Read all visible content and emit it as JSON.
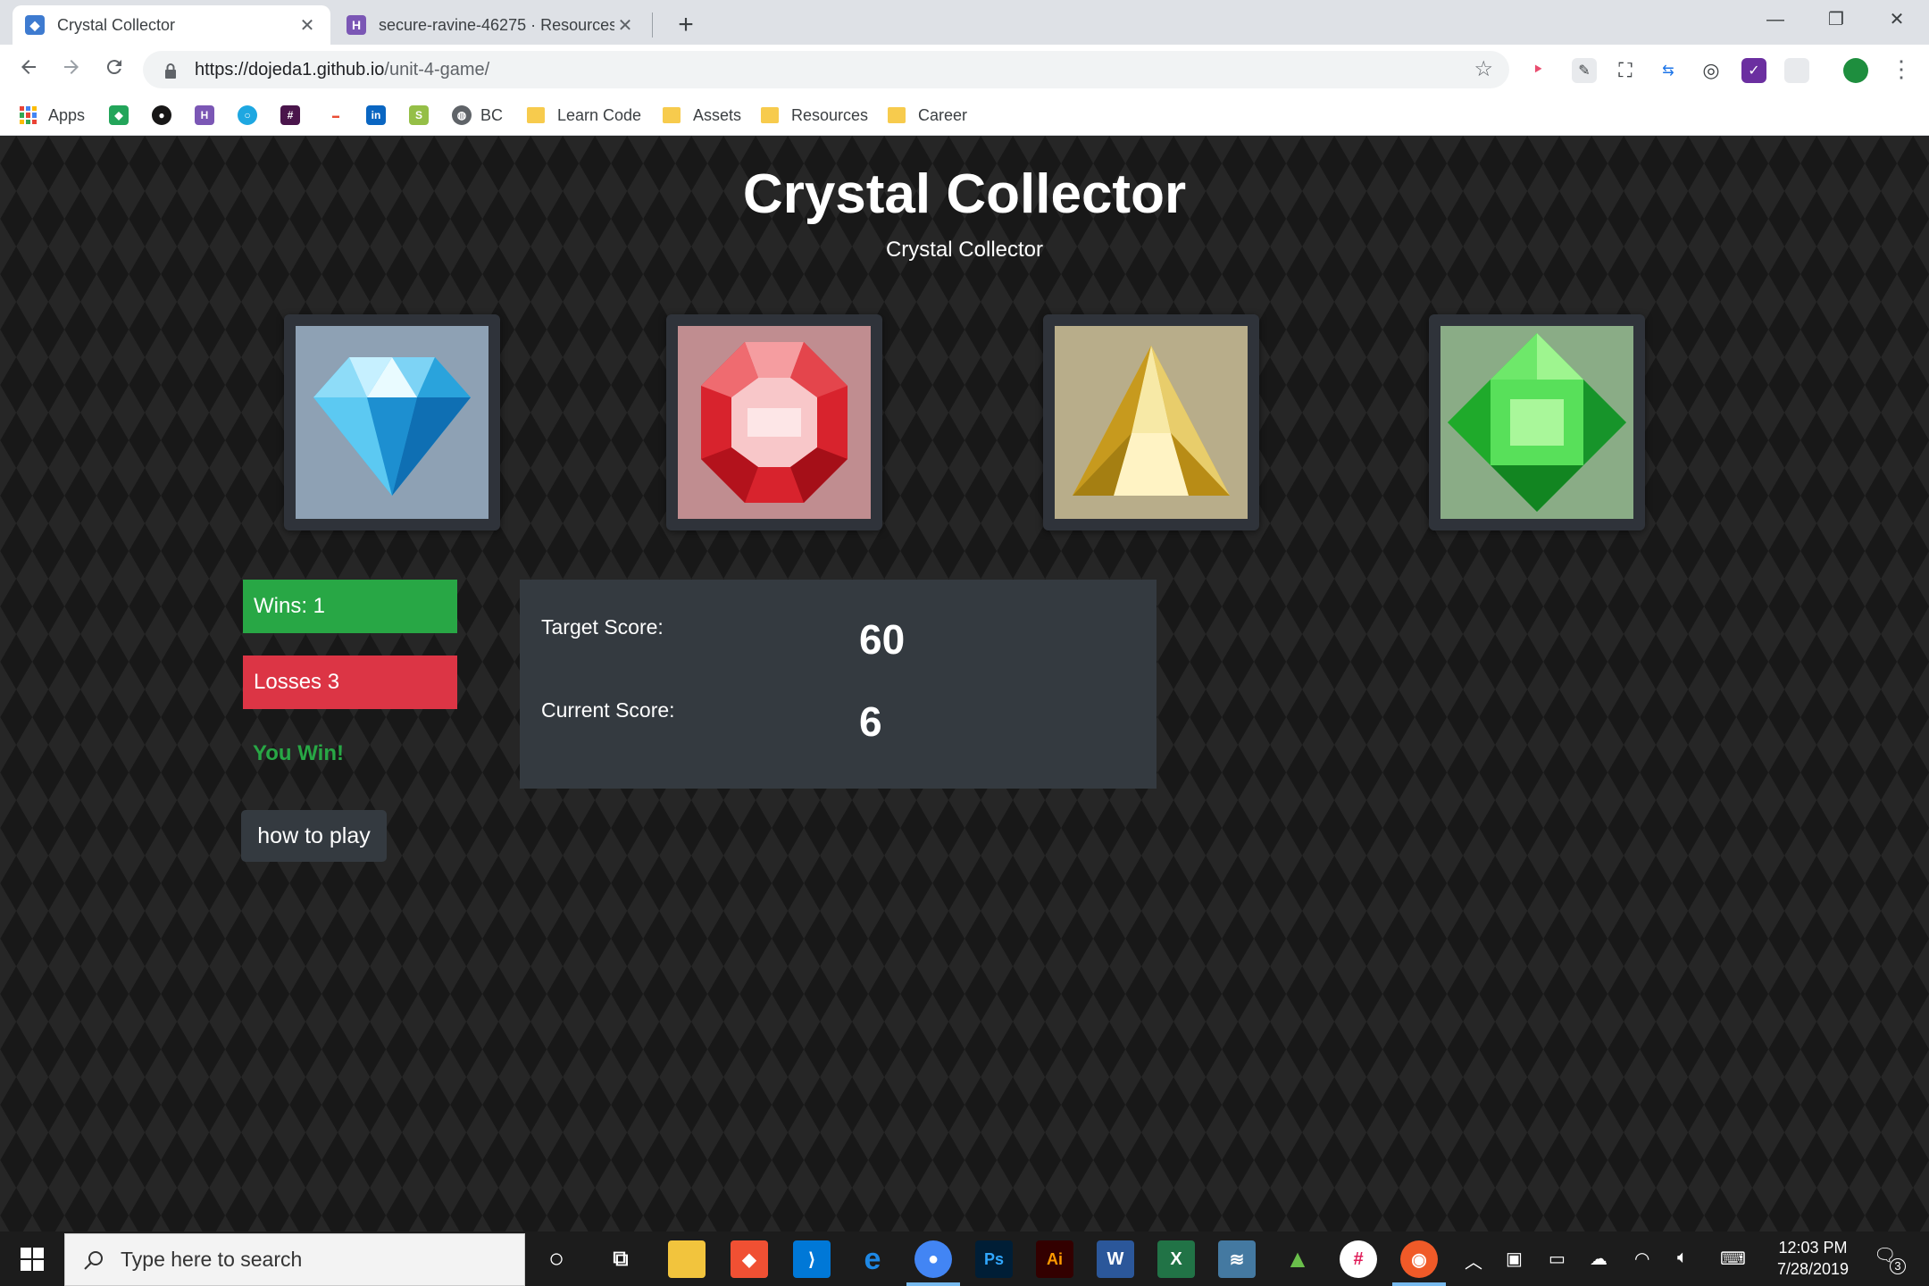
{
  "browser": {
    "tabs": [
      {
        "title": "Crystal Collector",
        "active": true,
        "favicon_color": "#3e7bd0",
        "close": "✕"
      },
      {
        "title": "secure-ravine-46275 · Resources",
        "active": false,
        "favicon_color": "#7b57b5",
        "close": "✕"
      }
    ],
    "new_tab": "+",
    "window_controls": {
      "minimize": "—",
      "restore": "❐",
      "close": "✕"
    },
    "url_host": "https://dojeda1.github.io",
    "url_path": "/unit-4-game/",
    "bookmarks": [
      {
        "label": "Apps",
        "type": "apps-grid"
      },
      {
        "label": "",
        "type": "app",
        "color": "#23a55a"
      },
      {
        "label": "",
        "type": "github",
        "color": "#181717"
      },
      {
        "label": "",
        "type": "app",
        "color": "#7b57b5"
      },
      {
        "label": "",
        "type": "app",
        "color": "#1ea7e1"
      },
      {
        "label": "",
        "type": "app",
        "color": "#4a154b"
      },
      {
        "label": "",
        "type": "app",
        "color": "#e94d35"
      },
      {
        "label": "",
        "type": "linkedin",
        "color": "#0a66c2"
      },
      {
        "label": "",
        "type": "shopify",
        "color": "#95bf47"
      },
      {
        "label": "BC",
        "type": "globe"
      },
      {
        "label": "Learn Code",
        "type": "folder"
      },
      {
        "label": "Assets",
        "type": "folder"
      },
      {
        "label": "Resources",
        "type": "folder"
      },
      {
        "label": "Career",
        "type": "folder"
      }
    ]
  },
  "game": {
    "title": "Crystal Collector",
    "subtitle": "Crystal Collector",
    "crystals": [
      {
        "name": "blue-diamond",
        "bg": "#8ea1b4",
        "color": "#3fb7ea"
      },
      {
        "name": "red-ruby",
        "bg": "#c08d90",
        "color": "#e2313a"
      },
      {
        "name": "yellow-topaz",
        "bg": "#b8ad8a",
        "color": "#d9b43a"
      },
      {
        "name": "green-emerald",
        "bg": "#8aac86",
        "color": "#2ec83a"
      }
    ],
    "wins_label": "Wins: 1",
    "losses_label": "Losses 3",
    "result": "You Win!",
    "how_to_play": "how to play",
    "target_label": "Target Score:",
    "target_value": "60",
    "current_label": "Current Score:",
    "current_value": "6"
  },
  "taskbar": {
    "search_placeholder": "Type here to search",
    "time": "12:03 PM",
    "date": "7/28/2019",
    "notification_count": "3"
  }
}
